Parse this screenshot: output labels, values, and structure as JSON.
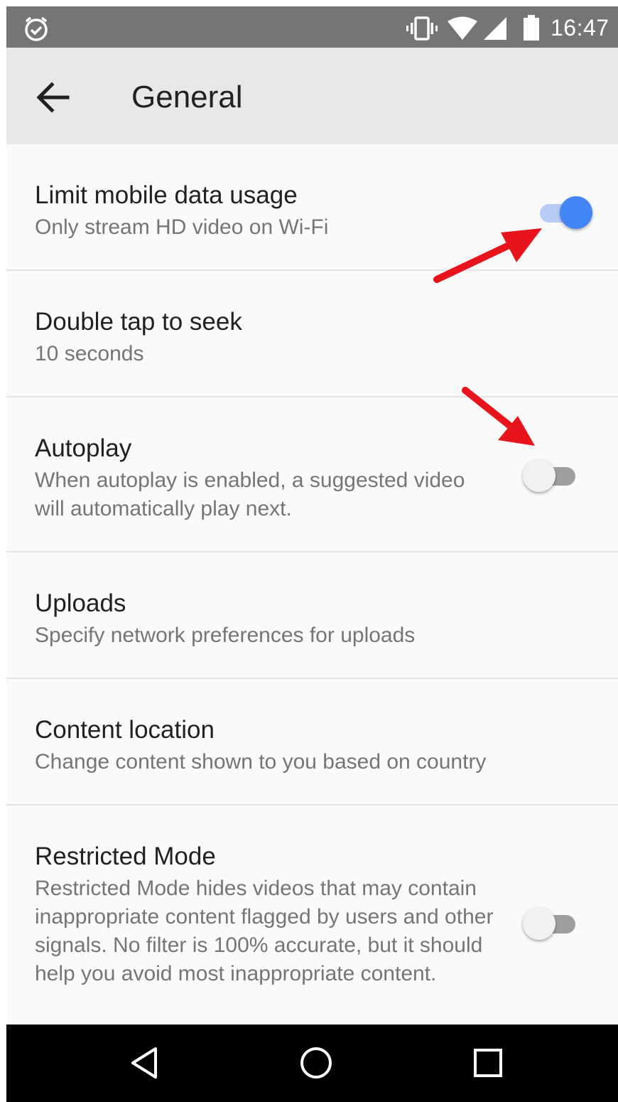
{
  "status_bar": {
    "time": "16:47",
    "icons": [
      "alarm-icon",
      "vibrate-icon",
      "wifi-icon",
      "signal-icon",
      "battery-icon"
    ]
  },
  "app_bar": {
    "back_icon": "arrow-back-icon",
    "title": "General"
  },
  "settings": [
    {
      "title": "Limit mobile data usage",
      "description": "Only stream HD video on Wi-Fi",
      "toggle": true
    },
    {
      "title": "Double tap to seek",
      "description": "10 seconds"
    },
    {
      "title": "Autoplay",
      "description": "When autoplay is enabled, a suggested video will automatically play next.",
      "toggle": false
    },
    {
      "title": "Uploads",
      "description": "Specify network preferences for uploads"
    },
    {
      "title": "Content location",
      "description": "Change content shown to you based on country"
    },
    {
      "title": "Restricted Mode",
      "description": "Restricted Mode hides videos that may contain inappropriate content flagged by users and other signals. No filter is 100% accurate, but it should help you avoid most inappropriate content.",
      "toggle": false
    }
  ],
  "nav_bar": {
    "buttons": [
      "back-triangle-icon",
      "home-circle-icon",
      "recents-square-icon"
    ]
  },
  "colors": {
    "status_bar": "#757575",
    "app_bar": "#e8e8e8",
    "toggle_on": "#4285f4",
    "toggle_on_track": "#b7cdf8",
    "annotation_arrow": "#e8141c"
  }
}
